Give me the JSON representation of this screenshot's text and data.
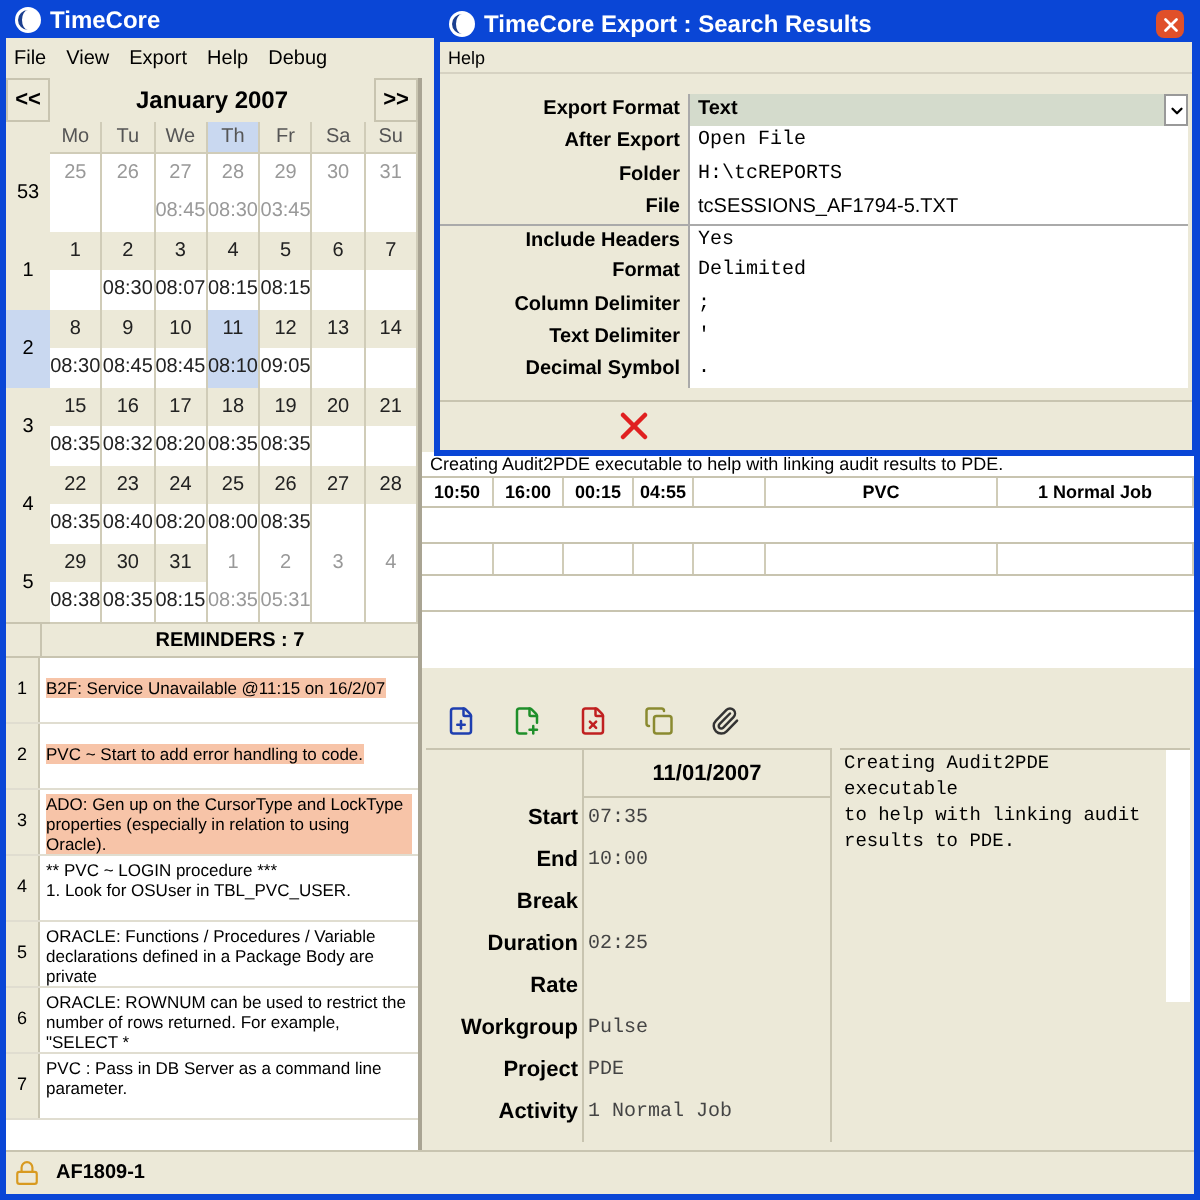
{
  "window": {
    "title": "TimeCore"
  },
  "menu": [
    "File",
    "View",
    "Export",
    "Help",
    "Debug"
  ],
  "calendar": {
    "prev": "<<",
    "next": ">>",
    "month": "January 2007",
    "weekdays": [
      {
        "label": "Mo",
        "selected": false
      },
      {
        "label": "Tu",
        "selected": false
      },
      {
        "label": "We",
        "selected": false
      },
      {
        "label": "Th",
        "selected": true
      },
      {
        "label": "Fr",
        "selected": false
      },
      {
        "label": "Sa",
        "selected": false
      },
      {
        "label": "Su",
        "selected": false
      }
    ],
    "weeks": [
      {
        "number": "53",
        "selected": false,
        "days": [
          {
            "date": "25",
            "in_month": false,
            "selected": false
          },
          {
            "date": "26",
            "in_month": false,
            "selected": false
          },
          {
            "date": "27",
            "time": "08:45",
            "in_month": false,
            "selected": false
          },
          {
            "date": "28",
            "time": "08:30",
            "in_month": false,
            "selected": false
          },
          {
            "date": "29",
            "time": "03:45",
            "in_month": false,
            "selected": false
          },
          {
            "date": "30",
            "in_month": false,
            "selected": false
          },
          {
            "date": "31",
            "in_month": false,
            "selected": false
          }
        ]
      },
      {
        "number": "1",
        "selected": false,
        "days": [
          {
            "date": "1",
            "in_month": true,
            "selected": false
          },
          {
            "date": "2",
            "time": "08:30",
            "in_month": true,
            "selected": false
          },
          {
            "date": "3",
            "time": "08:07",
            "in_month": true,
            "selected": false
          },
          {
            "date": "4",
            "time": "08:15",
            "in_month": true,
            "selected": false
          },
          {
            "date": "5",
            "time": "08:15",
            "in_month": true,
            "selected": false
          },
          {
            "date": "6",
            "in_month": true,
            "selected": false
          },
          {
            "date": "7",
            "in_month": true,
            "selected": false
          }
        ]
      },
      {
        "number": "2",
        "selected": true,
        "days": [
          {
            "date": "8",
            "time": "08:30",
            "in_month": true,
            "selected": false
          },
          {
            "date": "9",
            "time": "08:45",
            "in_month": true,
            "selected": false
          },
          {
            "date": "10",
            "time": "08:45",
            "in_month": true,
            "selected": false
          },
          {
            "date": "11",
            "time": "08:10",
            "in_month": true,
            "selected": true
          },
          {
            "date": "12",
            "time": "09:05",
            "in_month": true,
            "selected": false
          },
          {
            "date": "13",
            "in_month": true,
            "selected": false
          },
          {
            "date": "14",
            "in_month": true,
            "selected": false
          }
        ]
      },
      {
        "number": "3",
        "selected": false,
        "days": [
          {
            "date": "15",
            "time": "08:35",
            "in_month": true,
            "selected": false
          },
          {
            "date": "16",
            "time": "08:32",
            "in_month": true,
            "selected": false
          },
          {
            "date": "17",
            "time": "08:20",
            "in_month": true,
            "selected": false
          },
          {
            "date": "18",
            "time": "08:35",
            "in_month": true,
            "selected": false
          },
          {
            "date": "19",
            "time": "08:35",
            "in_month": true,
            "selected": false
          },
          {
            "date": "20",
            "in_month": true,
            "selected": false
          },
          {
            "date": "21",
            "in_month": true,
            "selected": false
          }
        ]
      },
      {
        "number": "4",
        "selected": false,
        "days": [
          {
            "date": "22",
            "time": "08:35",
            "in_month": true,
            "selected": false
          },
          {
            "date": "23",
            "time": "08:40",
            "in_month": true,
            "selected": false
          },
          {
            "date": "24",
            "time": "08:20",
            "in_month": true,
            "selected": false
          },
          {
            "date": "25",
            "time": "08:00",
            "in_month": true,
            "selected": false
          },
          {
            "date": "26",
            "time": "08:35",
            "in_month": true,
            "selected": false
          },
          {
            "date": "27",
            "in_month": true,
            "selected": false
          },
          {
            "date": "28",
            "in_month": true,
            "selected": false
          }
        ]
      },
      {
        "number": "5",
        "selected": false,
        "days": [
          {
            "date": "29",
            "time": "08:38",
            "in_month": true,
            "selected": false
          },
          {
            "date": "30",
            "time": "08:35",
            "in_month": true,
            "selected": false
          },
          {
            "date": "31",
            "time": "08:15",
            "in_month": true,
            "selected": false
          },
          {
            "date": "1",
            "time": "08:35",
            "in_month": false,
            "selected": false
          },
          {
            "date": "2",
            "time": "05:31",
            "in_month": false,
            "selected": false
          },
          {
            "date": "3",
            "in_month": false,
            "selected": false
          },
          {
            "date": "4",
            "in_month": false,
            "selected": false
          }
        ]
      }
    ]
  },
  "reminders": {
    "title": "REMINDERS : 7",
    "items": [
      {
        "number": "1",
        "text": "B2F: Service Unavailable @11:15 on 16/2/07",
        "color": "#f7c4a8"
      },
      {
        "number": "2",
        "text": "PVC ~ Start to add error handling to code.",
        "color": "#f7c4a8"
      },
      {
        "number": "3",
        "text": "ADO: Gen up on the CursorType and LockType properties (especially in relation to using Oracle).",
        "color": "#f7c4a8"
      },
      {
        "number": "4",
        "text": "** PVC ~ LOGIN procedure ***\n1. Look for OSUser in TBL_PVC_USER.",
        "color": "#ffffff"
      },
      {
        "number": "5",
        "text": "ORACLE: Functions / Procedures / Variable declarations defined in a Package Body are private",
        "color": "#ffffff"
      },
      {
        "number": "6",
        "text": "ORACLE: ROWNUM can be used to restrict the number of rows returned. For example, \"SELECT *",
        "color": "#ffffff"
      },
      {
        "number": "7",
        "text": "PVC : Pass in DB Server as a command line parameter.",
        "color": "#ffffff"
      }
    ]
  },
  "status_bar": {
    "user": "AF1809-1"
  },
  "sessions": {
    "note": "Creating Audit2PDE executable to help with linking audit results to PDE.",
    "rows": [
      [
        "10:50",
        "16:00",
        "00:15",
        "04:55",
        "",
        "PVC",
        "1 Normal Job"
      ]
    ]
  },
  "detail": {
    "date": "11/01/2007",
    "fields": [
      {
        "label": "Start",
        "value": "07:35"
      },
      {
        "label": "End",
        "value": "10:00"
      },
      {
        "label": "Break"
      },
      {
        "label": "Duration",
        "value": "02:25"
      },
      {
        "label": "Rate"
      },
      {
        "label": "Workgroup",
        "value": "Pulse"
      },
      {
        "label": "Project",
        "value": "PDE"
      },
      {
        "label": "Activity",
        "value": "1 Normal Job"
      }
    ],
    "notes": "Creating Audit2PDE executable\nto help with linking audit\nresults to PDE."
  },
  "dialog": {
    "title": "TimeCore Export : Search Results",
    "menu": [
      "Help"
    ],
    "fields": [
      {
        "label": "Export Format",
        "value": "Text",
        "kind": "dropdown"
      },
      {
        "label": "After Export",
        "value": "Open File",
        "kind": "mono"
      },
      {
        "label": "Folder",
        "value": "H:\\tcREPORTS",
        "kind": "mono"
      },
      {
        "label": "File",
        "value": "tcSESSIONS_AF1794-5.TXT",
        "kind": "plain"
      },
      {
        "label": "Include Headers",
        "value": "Yes",
        "kind": "mono"
      },
      {
        "label": "Format",
        "value": "Delimited",
        "kind": "mono"
      },
      {
        "label": "Column Delimiter",
        "value": ";",
        "kind": "mono"
      },
      {
        "label": "Text Delimiter",
        "value": "'",
        "kind": "mono"
      },
      {
        "label": "Decimal Symbol",
        "value": ".",
        "kind": "mono"
      }
    ]
  }
}
